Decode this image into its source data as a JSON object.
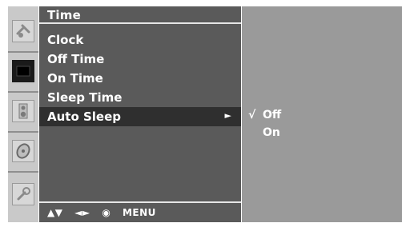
{
  "menu": {
    "title": "Time",
    "items": [
      {
        "label": "Clock"
      },
      {
        "label": "Off Time"
      },
      {
        "label": "On Time"
      },
      {
        "label": "Sleep Time"
      },
      {
        "label": "Auto Sleep",
        "selected": true
      }
    ],
    "selected_arrow": "►"
  },
  "submenu": {
    "options": [
      {
        "label": "Off",
        "checked": true
      },
      {
        "label": "On",
        "checked": false
      }
    ],
    "check_mark": "√"
  },
  "footer": {
    "nav": "▲▼",
    "lr": "◄►",
    "ok": "◉",
    "menu": "MENU"
  },
  "rail": {
    "icons": [
      "satellite-icon",
      "picture-icon",
      "speaker-icon",
      "disc-icon",
      "key-icon"
    ],
    "active_index": 1
  },
  "colors": {
    "menu_bg": "#5a5a5a",
    "selected_bg": "#2f2f2f",
    "submenu_bg": "#9a9a9a",
    "rail_bg": "#c9c9c9"
  }
}
